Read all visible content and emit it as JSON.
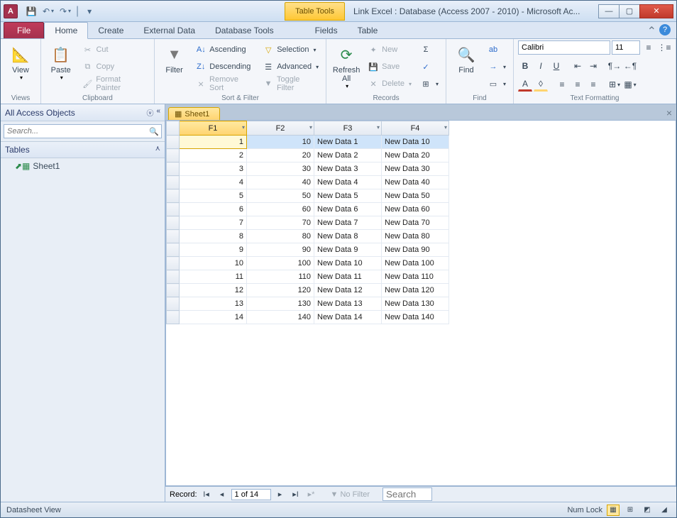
{
  "titlebar": {
    "app_letter": "A",
    "table_tools": "Table Tools",
    "title": "Link Excel : Database (Access 2007 - 2010)  -  Microsoft Ac..."
  },
  "tabs": {
    "file": "File",
    "home": "Home",
    "create": "Create",
    "external": "External Data",
    "dbtools": "Database Tools",
    "fields": "Fields",
    "table": "Table"
  },
  "ribbon": {
    "views": {
      "view": "View",
      "label": "Views"
    },
    "clipboard": {
      "paste": "Paste",
      "cut": "Cut",
      "copy": "Copy",
      "fmt": "Format Painter",
      "label": "Clipboard"
    },
    "sortfilter": {
      "filter": "Filter",
      "asc": "Ascending",
      "desc": "Descending",
      "remove": "Remove Sort",
      "sel": "Selection",
      "adv": "Advanced",
      "toggle": "Toggle Filter",
      "label": "Sort & Filter"
    },
    "records": {
      "refresh": "Refresh\nAll",
      "new": "New",
      "save": "Save",
      "delete": "Delete",
      "totals": "Σ",
      "label": "Records"
    },
    "find": {
      "find": "Find",
      "label": "Find"
    },
    "text": {
      "font": "Calibri",
      "size": "11",
      "label": "Text Formatting"
    }
  },
  "nav": {
    "header": "All Access Objects",
    "search_placeholder": "Search...",
    "group": "Tables",
    "item": "Sheet1"
  },
  "doc": {
    "tab": "Sheet1",
    "close": "×"
  },
  "columns": [
    "F1",
    "F2",
    "F3",
    "F4"
  ],
  "rows": [
    {
      "f1": "1",
      "f2": "10",
      "f3": "New Data 1",
      "f4": "New Data 10"
    },
    {
      "f1": "2",
      "f2": "20",
      "f3": "New Data 2",
      "f4": "New Data 20"
    },
    {
      "f1": "3",
      "f2": "30",
      "f3": "New Data 3",
      "f4": "New Data 30"
    },
    {
      "f1": "4",
      "f2": "40",
      "f3": "New Data 4",
      "f4": "New Data 40"
    },
    {
      "f1": "5",
      "f2": "50",
      "f3": "New Data 5",
      "f4": "New Data 50"
    },
    {
      "f1": "6",
      "f2": "60",
      "f3": "New Data 6",
      "f4": "New Data 60"
    },
    {
      "f1": "7",
      "f2": "70",
      "f3": "New Data 7",
      "f4": "New Data 70"
    },
    {
      "f1": "8",
      "f2": "80",
      "f3": "New Data 8",
      "f4": "New Data 80"
    },
    {
      "f1": "9",
      "f2": "90",
      "f3": "New Data 9",
      "f4": "New Data 90"
    },
    {
      "f1": "10",
      "f2": "100",
      "f3": "New Data 10",
      "f4": "New Data 100"
    },
    {
      "f1": "11",
      "f2": "110",
      "f3": "New Data 11",
      "f4": "New Data 110"
    },
    {
      "f1": "12",
      "f2": "120",
      "f3": "New Data 12",
      "f4": "New Data 120"
    },
    {
      "f1": "13",
      "f2": "130",
      "f3": "New Data 13",
      "f4": "New Data 130"
    },
    {
      "f1": "14",
      "f2": "140",
      "f3": "New Data 14",
      "f4": "New Data 140"
    }
  ],
  "recordnav": {
    "label": "Record:",
    "pos": "1 of 14",
    "nofilter": "No Filter",
    "search": "Search"
  },
  "status": {
    "left": "Datasheet View",
    "numlock": "Num Lock"
  }
}
